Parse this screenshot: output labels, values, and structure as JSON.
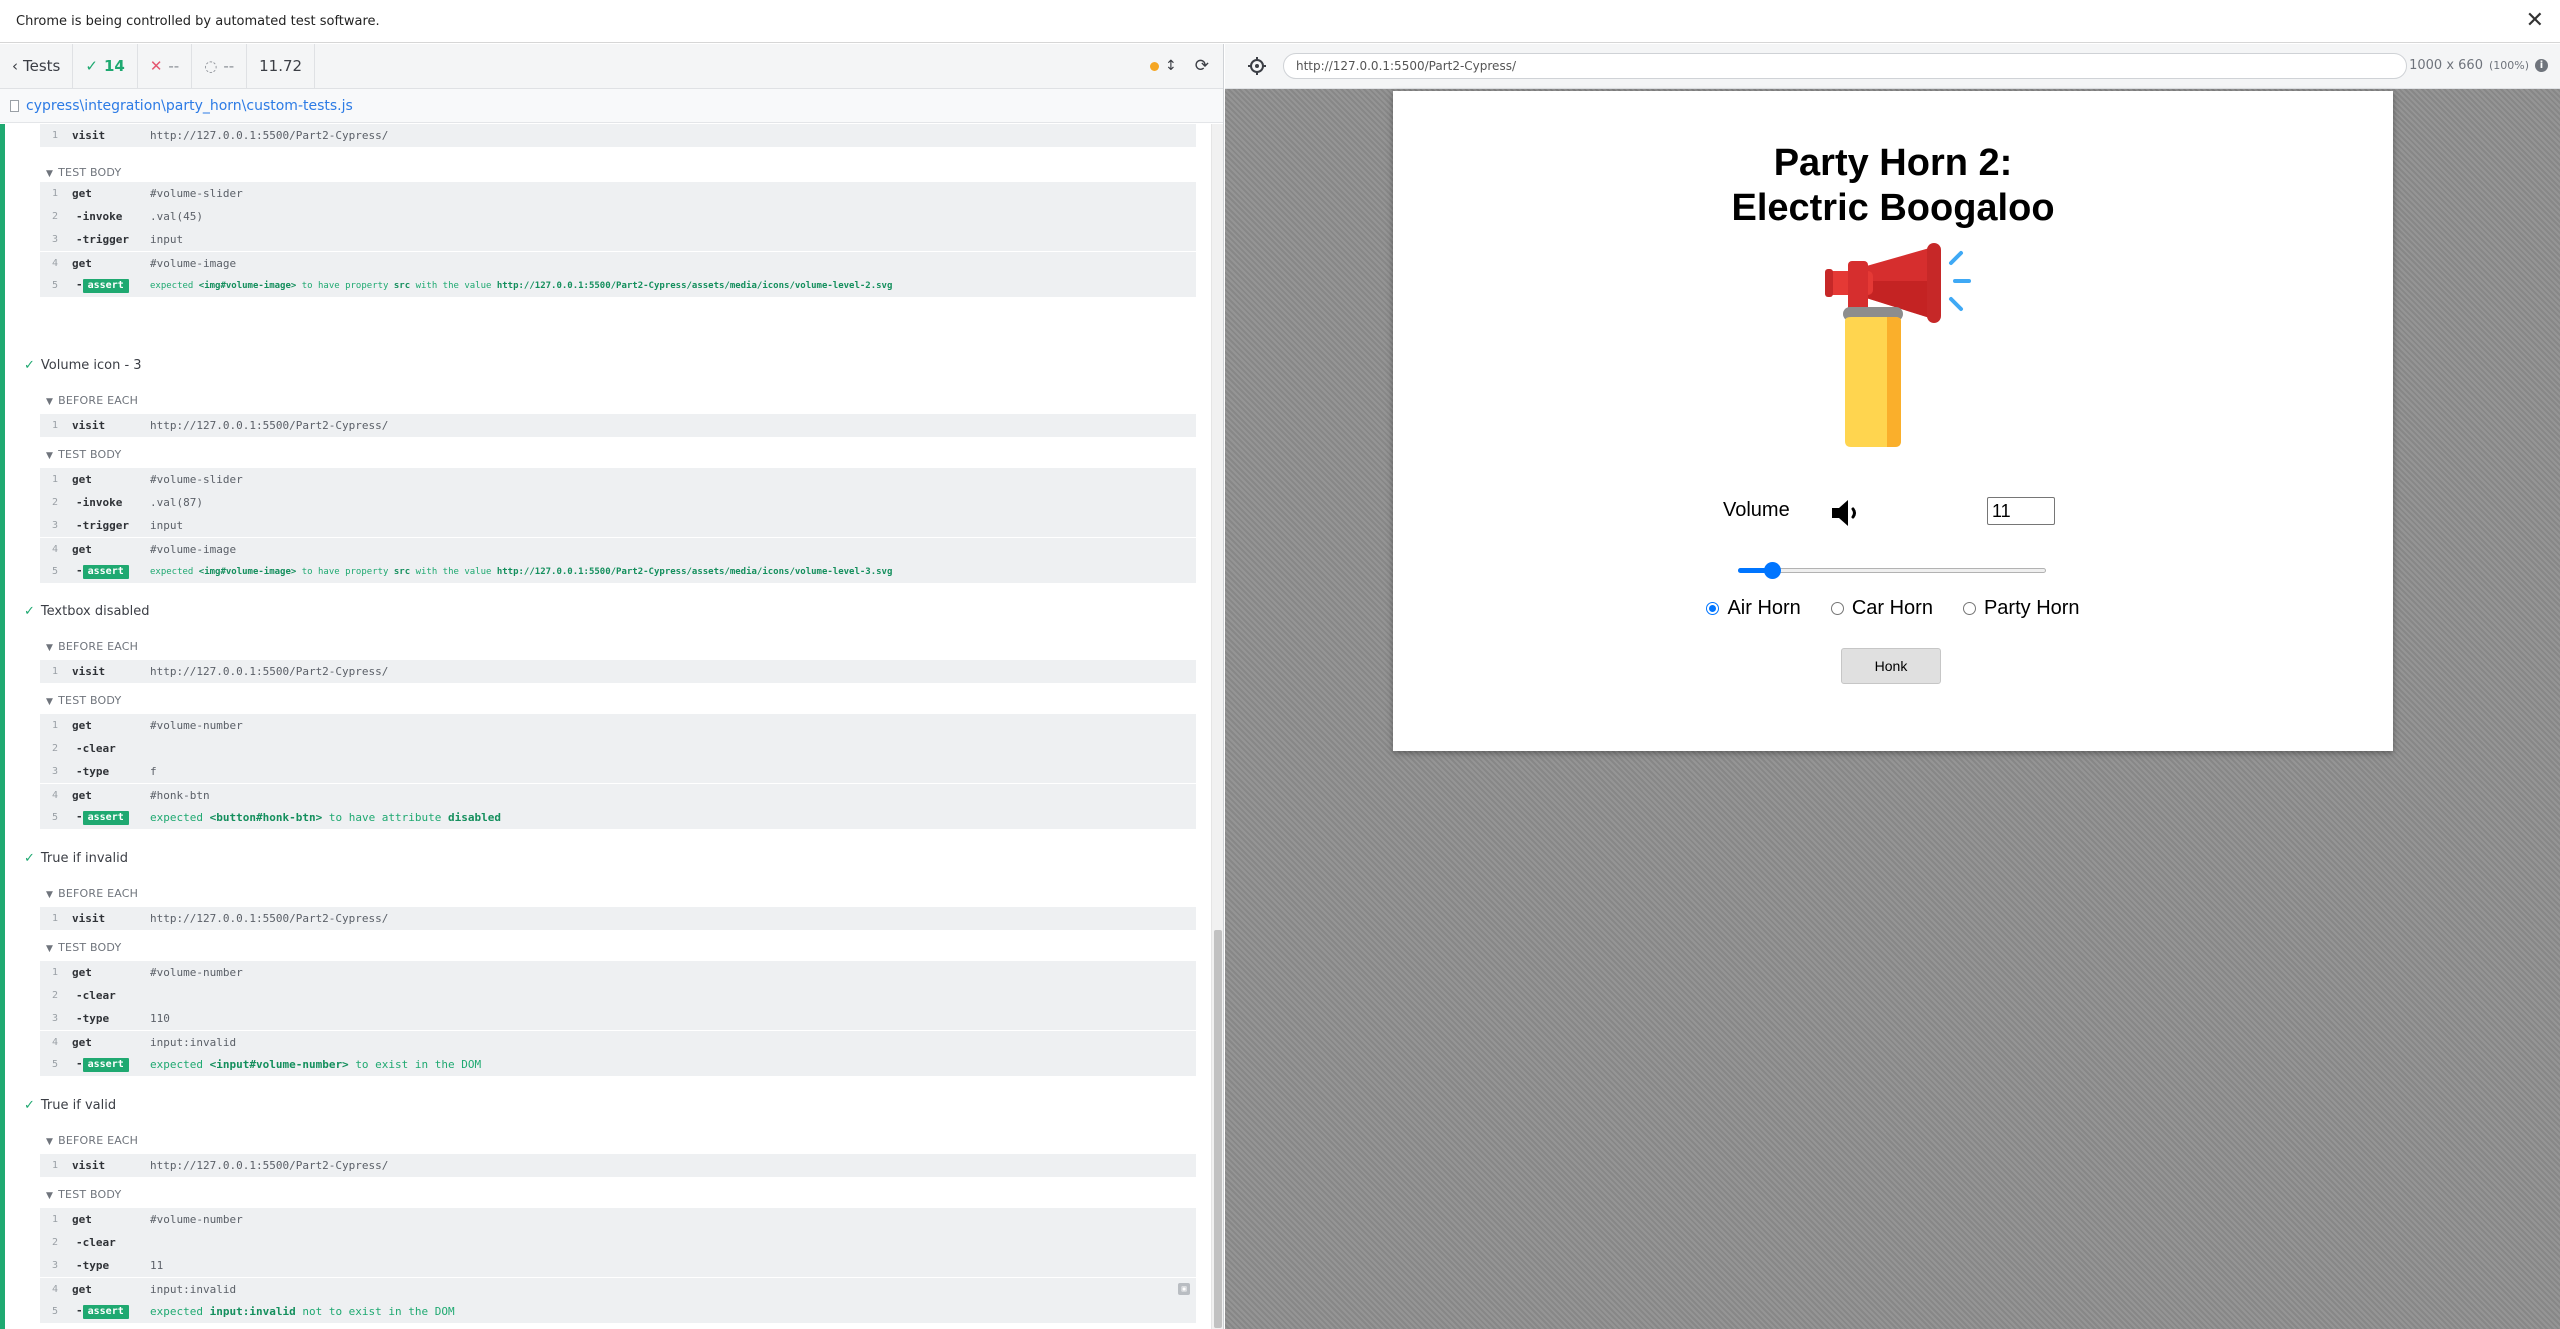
{
  "infobar": {
    "message": "Chrome is being controlled by automated test software.",
    "close": "✕"
  },
  "reporter": {
    "tests_label": "Tests",
    "passed": "14",
    "failed": "--",
    "pending": "--",
    "duration": "11.72",
    "spec_path": "cypress\\integration\\party_horn\\custom-tests.js"
  },
  "tests": {
    "t0": {
      "before_visit": "http://127.0.0.1:5500/Part2-Cypress/",
      "body_label": "TEST BODY",
      "c1": "#volume-slider",
      "c2": ".val(45)",
      "c3": "input",
      "c4": "#volume-image",
      "a_pre": "expected",
      "a_subj": "<img#volume-image>",
      "a_mid": "to have property",
      "a_prop": "src",
      "a_mid2": "with the value",
      "a_val": "http://127.0.0.1:5500/Part2-Cypress/assets/media/icons/volume-level-2.svg"
    },
    "t1": {
      "title": "Volume icon - 3",
      "before_label": "BEFORE EACH",
      "before_visit": "http://127.0.0.1:5500/Part2-Cypress/",
      "body_label": "TEST BODY",
      "c1": "#volume-slider",
      "c2": ".val(87)",
      "c3": "input",
      "c4": "#volume-image",
      "a_pre": "expected",
      "a_subj": "<img#volume-image>",
      "a_mid": "to have property",
      "a_prop": "src",
      "a_mid2": "with the value",
      "a_val": "http://127.0.0.1:5500/Part2-Cypress/assets/media/icons/volume-level-3.svg"
    },
    "t2": {
      "title": "Textbox disabled",
      "before_label": "BEFORE EACH",
      "before_visit": "http://127.0.0.1:5500/Part2-Cypress/",
      "body_label": "TEST BODY",
      "c1": "#volume-number",
      "c3": "f",
      "c4": "#honk-btn",
      "a_pre": "expected",
      "a_subj": "<button#honk-btn>",
      "a_mid": "to have attribute",
      "a_prop": "disabled"
    },
    "t3": {
      "title": "True if invalid",
      "before_label": "BEFORE EACH",
      "before_visit": "http://127.0.0.1:5500/Part2-Cypress/",
      "body_label": "TEST BODY",
      "c1": "#volume-number",
      "c3": "110",
      "c4": "input:invalid",
      "a_pre": "expected",
      "a_subj": "<input#volume-number>",
      "a_mid": "to exist in the DOM"
    },
    "t4": {
      "title": "True if valid",
      "before_label": "BEFORE EACH",
      "before_visit": "http://127.0.0.1:5500/Part2-Cypress/",
      "body_label": "TEST BODY",
      "c1": "#volume-number",
      "c3": "11",
      "c4": "input:invalid",
      "a_pre": "expected",
      "a_subj": "input:invalid",
      "a_mid": "not to exist in the DOM"
    }
  },
  "commands": {
    "visit": "visit",
    "get": "get",
    "invoke": "-invoke",
    "trigger": "-trigger",
    "clear": "-clear",
    "type": "-type",
    "assert": "assert",
    "dash": "-"
  },
  "aut": {
    "url": "http://127.0.0.1:5500/Part2-Cypress/",
    "viewport": "1000 x 660",
    "scale": "(100%)",
    "info": "i"
  },
  "app": {
    "title_line1": "Party Horn 2:",
    "title_line2": "Electric Boogaloo",
    "volume_label": "Volume",
    "volume_value": "11",
    "slider_value": 11,
    "radios": [
      "Air Horn",
      "Car Horn",
      "Party Horn"
    ],
    "selected_radio": "Air Horn",
    "honk_label": "Honk"
  },
  "colors": {
    "pass": "#1fa971",
    "fail": "#e45770",
    "accent": "#0075ff",
    "horn_red": "#d62e2e",
    "horn_yellow": "#ffd54f"
  }
}
